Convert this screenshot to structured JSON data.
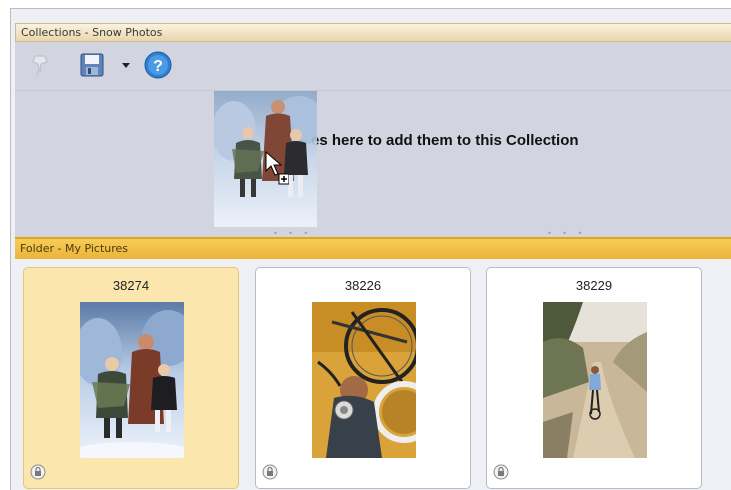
{
  "collections": {
    "header_title": "Collections - Snow Photos",
    "toolbar": {
      "icons": [
        "pin-icon",
        "save-icon",
        "dropdown-arrow-icon",
        "help-icon"
      ]
    },
    "dropzone_text": "es here to add them to this Collection"
  },
  "folder": {
    "header_title": "Folder - My Pictures",
    "items": [
      {
        "label": "38274",
        "selected": true,
        "subject": "children in snow"
      },
      {
        "label": "38226",
        "selected": false,
        "subject": "man with bicycle"
      },
      {
        "label": "38229",
        "selected": false,
        "subject": "cyclist on dirt road"
      }
    ]
  },
  "colors": {
    "collection_header": "#e9d6ad",
    "folder_header": "#eab43a",
    "selected_tile": "#fbe7ae",
    "panel_bg": "#d2d5e0"
  }
}
